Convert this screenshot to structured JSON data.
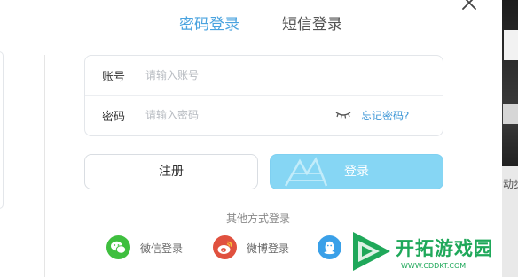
{
  "tabs": [
    {
      "label": "密码登录",
      "active": true
    },
    {
      "label": "短信登录",
      "active": false
    }
  ],
  "form": {
    "account": {
      "label": "账号",
      "placeholder": "请输入账号",
      "value": ""
    },
    "password": {
      "label": "密码",
      "placeholder": "请输入密码",
      "value": ""
    },
    "forgot_label": "忘记密码?"
  },
  "buttons": {
    "register_label": "注册",
    "login_label": "登录"
  },
  "other_login": {
    "title": "其他方式登录",
    "options": [
      {
        "label": "微信登录",
        "icon": "wechat-icon",
        "color": "#3fbf3f"
      },
      {
        "label": "微博登录",
        "icon": "weibo-icon",
        "color": "#e0513f"
      },
      {
        "label": "",
        "icon": "qq-icon",
        "color": "#3aa0e8"
      }
    ]
  },
  "background": {
    "right_strip_text": "动步"
  },
  "watermark": {
    "name": "开拓游戏园",
    "url": "WWW.CDDKT.COM"
  },
  "colors": {
    "accent": "#4aa3df",
    "login_button": "#86d6f4",
    "link": "#3a95d6",
    "brand": "#1fa85a"
  }
}
